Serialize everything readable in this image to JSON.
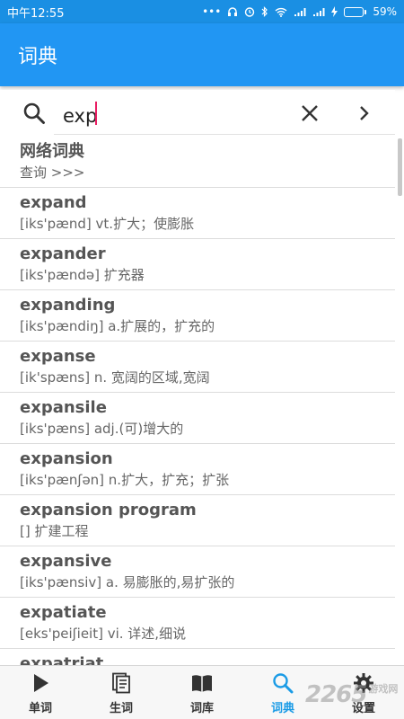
{
  "statusbar": {
    "time": "中午12:55",
    "dots": "•••",
    "battery": "59%",
    "battery_level": 0.59
  },
  "appbar": {
    "title": "词典"
  },
  "search": {
    "value": "exp"
  },
  "web_dict": {
    "title": "网络词典",
    "action": "查询 >>>"
  },
  "results": [
    {
      "word": "expand",
      "def": "[iks'pænd] vt.扩大；使膨胀"
    },
    {
      "word": "expander",
      "def": "[iks'pændə] 扩充器"
    },
    {
      "word": "expanding",
      "def": "[iks'pændiŋ] a.扩展的，扩充的"
    },
    {
      "word": "expanse",
      "def": "[ik'spæns] n. 宽阔的区域,宽阔"
    },
    {
      "word": "expansile",
      "def": "[iks'pæns] adj.(可)增大的"
    },
    {
      "word": "expansion",
      "def": "[iks'pænʃən] n.扩大，扩充；扩张"
    },
    {
      "word": "expansion program",
      "def": "[] 扩建工程"
    },
    {
      "word": "expansive",
      "def": "[iks'pænsiv] a. 易膨胀的,易扩张的"
    },
    {
      "word": "expatiate",
      "def": "[eks'peiʃieit] vi. 详述,细说"
    },
    {
      "word": "expatriat",
      "def": ""
    }
  ],
  "bottom_nav": [
    {
      "label": "单词",
      "icon": "play-icon"
    },
    {
      "label": "生词",
      "icon": "notes-icon"
    },
    {
      "label": "词库",
      "icon": "book-icon"
    },
    {
      "label": "词典",
      "icon": "search-icon",
      "active": true
    },
    {
      "label": "设置",
      "icon": "gear-icon"
    }
  ],
  "watermark": {
    "text": "2265",
    "suffix": "游戏网"
  },
  "colors": {
    "primary": "#2196f3",
    "status": "#1a8fe3",
    "active": "#1a9be6",
    "caret": "#e91e63"
  }
}
